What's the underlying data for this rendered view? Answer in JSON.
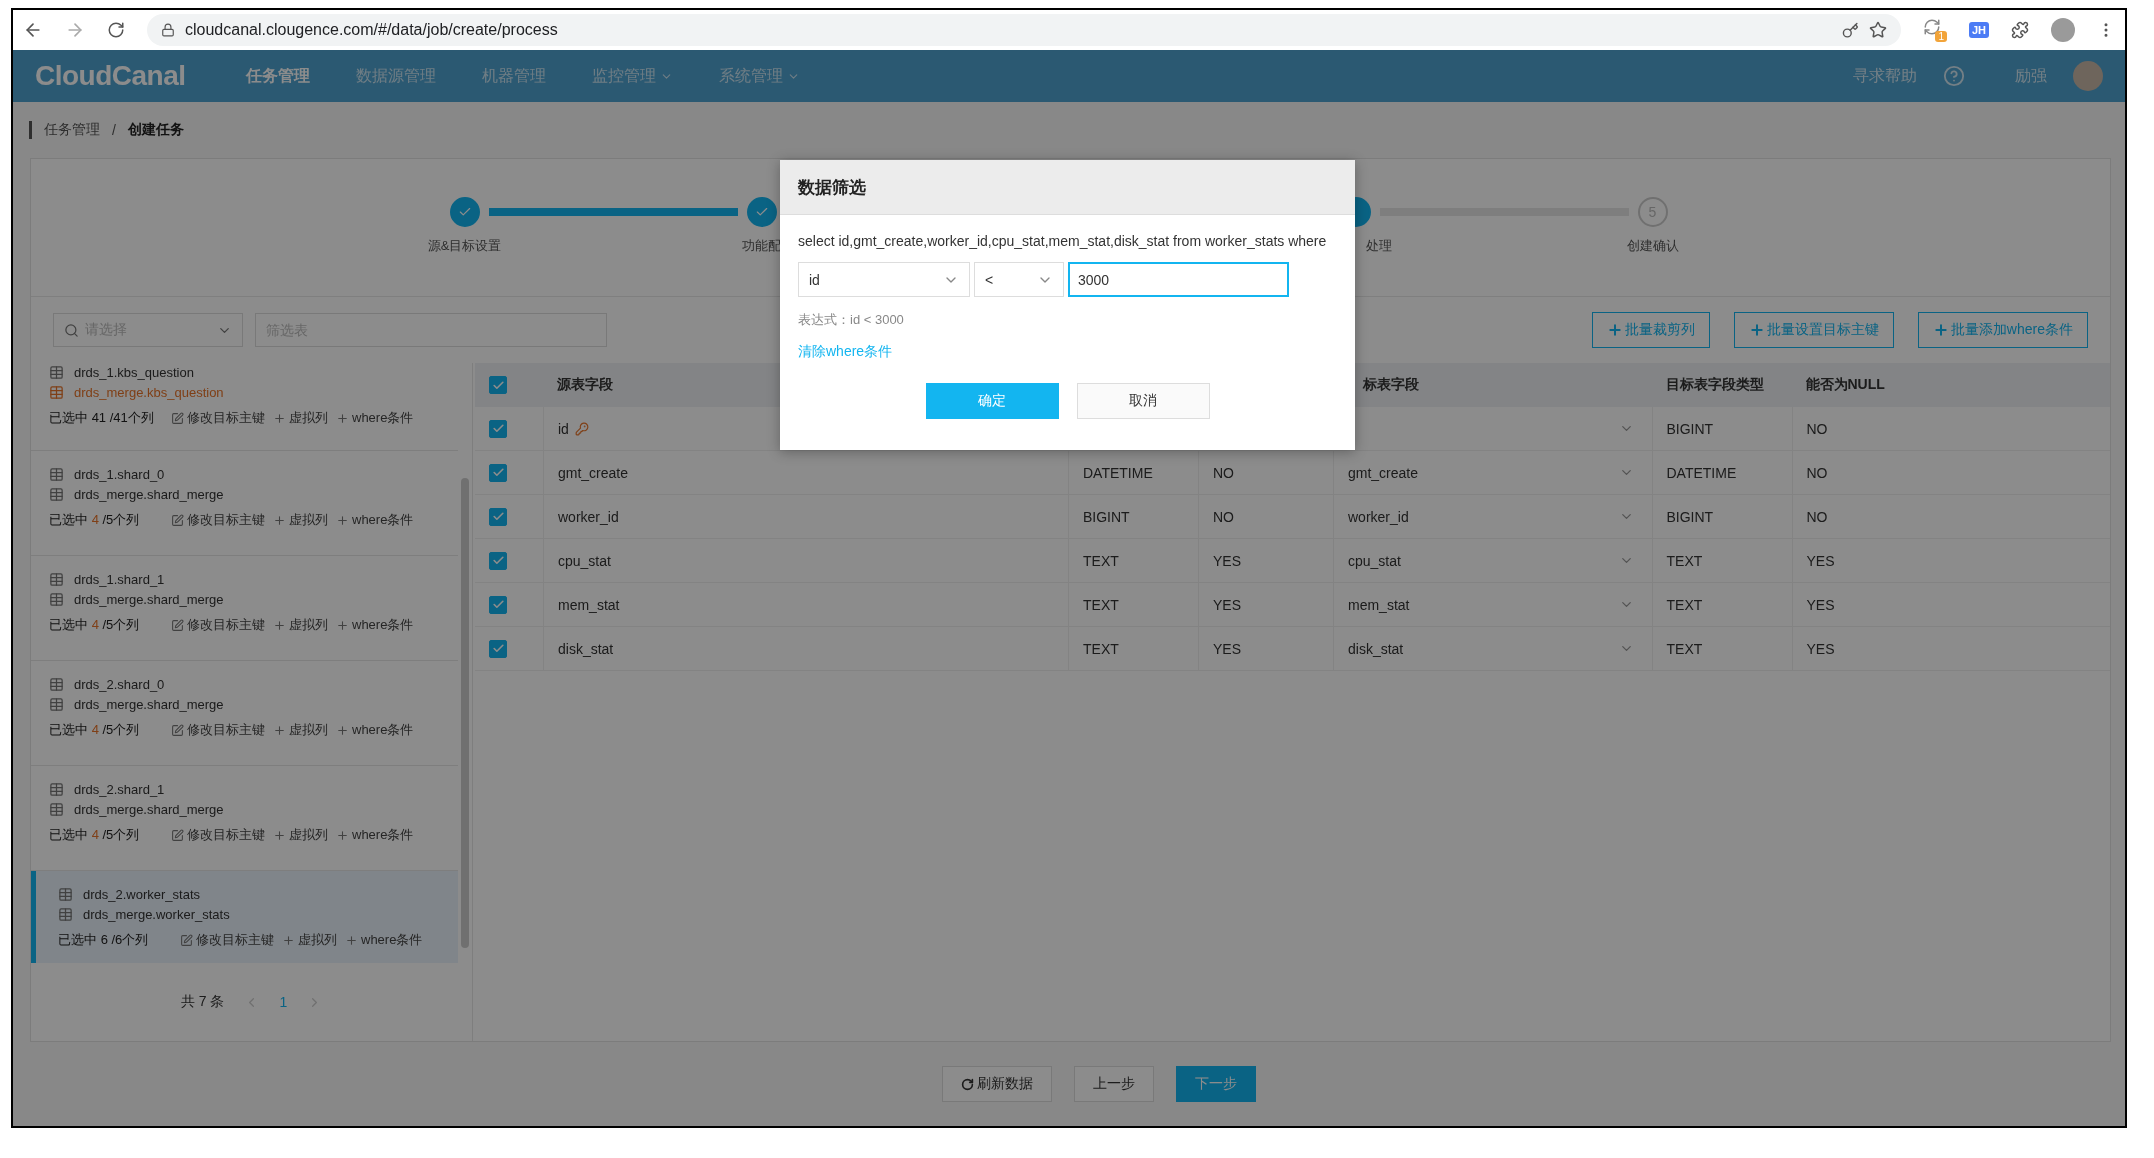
{
  "browser": {
    "url": "cloudcanal.clougence.com/#/data/job/create/process",
    "extension_badge": "1",
    "extension_label": "JH"
  },
  "nav": {
    "logo": "CloudCanal",
    "items": [
      {
        "label": "任务管理",
        "selected": true,
        "dropdown": false
      },
      {
        "label": "数据源管理",
        "selected": false,
        "dropdown": false
      },
      {
        "label": "机器管理",
        "selected": false,
        "dropdown": false
      },
      {
        "label": "监控管理",
        "selected": false,
        "dropdown": true
      },
      {
        "label": "系统管理",
        "selected": false,
        "dropdown": true
      }
    ],
    "help": "寻求帮助",
    "user": "励强"
  },
  "breadcrumb": {
    "items": [
      "任务管理",
      "创建任务"
    ],
    "separator": "/"
  },
  "steps": [
    {
      "label": "源&目标设置",
      "kind": "done"
    },
    {
      "label": "功能配",
      "kind": "done"
    },
    {
      "label": "处理",
      "kind": "current"
    },
    {
      "label": "创建确认",
      "number": "5",
      "kind": "pending"
    }
  ],
  "toolbar": {
    "select_placeholder": "请选择",
    "filter_placeholder": "筛选表",
    "buttons": [
      "批量裁剪列",
      "批量设置目标主键",
      "批量添加where条件"
    ]
  },
  "tables": [
    {
      "source": "drds_1.kbs_question",
      "target": "drds_merge.kbs_question",
      "target_error": true,
      "count_label": "已选中",
      "selected_count": "41",
      "total": "/41个列",
      "partial": false,
      "selected": false,
      "actions": [
        {
          "kind": "edit",
          "label": "修改目标主键"
        },
        {
          "kind": "add",
          "label": "虚拟列"
        },
        {
          "kind": "add",
          "label": "where条件"
        }
      ]
    },
    {
      "source": "drds_1.shard_0",
      "target": "drds_merge.shard_merge",
      "target_error": false,
      "count_label": "已选中",
      "selected_count": "4",
      "total": "/5个列",
      "partial": true,
      "selected": false,
      "actions": [
        {
          "kind": "edit",
          "label": "修改目标主键"
        },
        {
          "kind": "add",
          "label": "虚拟列"
        },
        {
          "kind": "add",
          "label": "where条件"
        }
      ]
    },
    {
      "source": "drds_1.shard_1",
      "target": "drds_merge.shard_merge",
      "target_error": false,
      "count_label": "已选中",
      "selected_count": "4",
      "total": "/5个列",
      "partial": true,
      "selected": false,
      "actions": [
        {
          "kind": "edit",
          "label": "修改目标主键"
        },
        {
          "kind": "add",
          "label": "虚拟列"
        },
        {
          "kind": "add",
          "label": "where条件"
        }
      ]
    },
    {
      "source": "drds_2.shard_0",
      "target": "drds_merge.shard_merge",
      "target_error": false,
      "count_label": "已选中",
      "selected_count": "4",
      "total": "/5个列",
      "partial": true,
      "selected": false,
      "actions": [
        {
          "kind": "edit",
          "label": "修改目标主键"
        },
        {
          "kind": "add",
          "label": "虚拟列"
        },
        {
          "kind": "add",
          "label": "where条件"
        }
      ]
    },
    {
      "source": "drds_2.shard_1",
      "target": "drds_merge.shard_merge",
      "target_error": false,
      "count_label": "已选中",
      "selected_count": "4",
      "total": "/5个列",
      "partial": true,
      "selected": false,
      "actions": [
        {
          "kind": "edit",
          "label": "修改目标主键"
        },
        {
          "kind": "add",
          "label": "虚拟列"
        },
        {
          "kind": "add",
          "label": "where条件"
        }
      ]
    },
    {
      "source": "drds_2.worker_stats",
      "target": "drds_merge.worker_stats",
      "target_error": false,
      "count_label": "已选中",
      "selected_count": "6",
      "total": "/6个列",
      "partial": false,
      "selected": true,
      "actions": [
        {
          "kind": "edit",
          "label": "修改目标主键"
        },
        {
          "kind": "add",
          "label": "虚拟列"
        },
        {
          "kind": "add",
          "label": "where条件"
        }
      ]
    }
  ],
  "pagination": {
    "total": "共 7 条",
    "pages": [
      {
        "label": "1",
        "selected": true
      }
    ]
  },
  "table": {
    "header": {
      "all_checked": true,
      "source": "源表字段",
      "target": "标表字段",
      "target_type": "目标表字段类型",
      "target_nullable": "能否为NULL"
    },
    "rows": [
      {
        "checked": true,
        "source": "id",
        "primary_key": true,
        "target_type": "BIGINT",
        "target_nullable": "NO"
      },
      {
        "checked": true,
        "source": "gmt_create",
        "primary_key": false,
        "type": "DATETIME",
        "nullable": "NO",
        "target": "gmt_create",
        "target_type": "DATETIME",
        "target_nullable": "NO"
      },
      {
        "checked": true,
        "source": "worker_id",
        "primary_key": false,
        "type": "BIGINT",
        "nullable": "NO",
        "target": "worker_id",
        "target_type": "BIGINT",
        "target_nullable": "NO"
      },
      {
        "checked": true,
        "source": "cpu_stat",
        "primary_key": false,
        "type": "TEXT",
        "nullable": "YES",
        "target": "cpu_stat",
        "target_type": "TEXT",
        "target_nullable": "YES"
      },
      {
        "checked": true,
        "source": "mem_stat",
        "primary_key": false,
        "type": "TEXT",
        "nullable": "YES",
        "target": "mem_stat",
        "target_type": "TEXT",
        "target_nullable": "YES"
      },
      {
        "checked": true,
        "source": "disk_stat",
        "primary_key": false,
        "type": "TEXT",
        "nullable": "YES",
        "target": "disk_stat",
        "target_type": "TEXT",
        "target_nullable": "YES"
      }
    ]
  },
  "footer": {
    "refresh": "刷新数据",
    "prev": "上一步",
    "next": "下一步"
  },
  "modal": {
    "title": "数据筛选",
    "sql": "select id,gmt_create,worker_id,cpu_stat,mem_stat,disk_stat from worker_stats where",
    "field": "id",
    "operator": "<",
    "value": "3000",
    "expression": "表达式：id < 3000",
    "clear_link": "清除where条件",
    "ok": "确定",
    "cancel": "取消"
  }
}
